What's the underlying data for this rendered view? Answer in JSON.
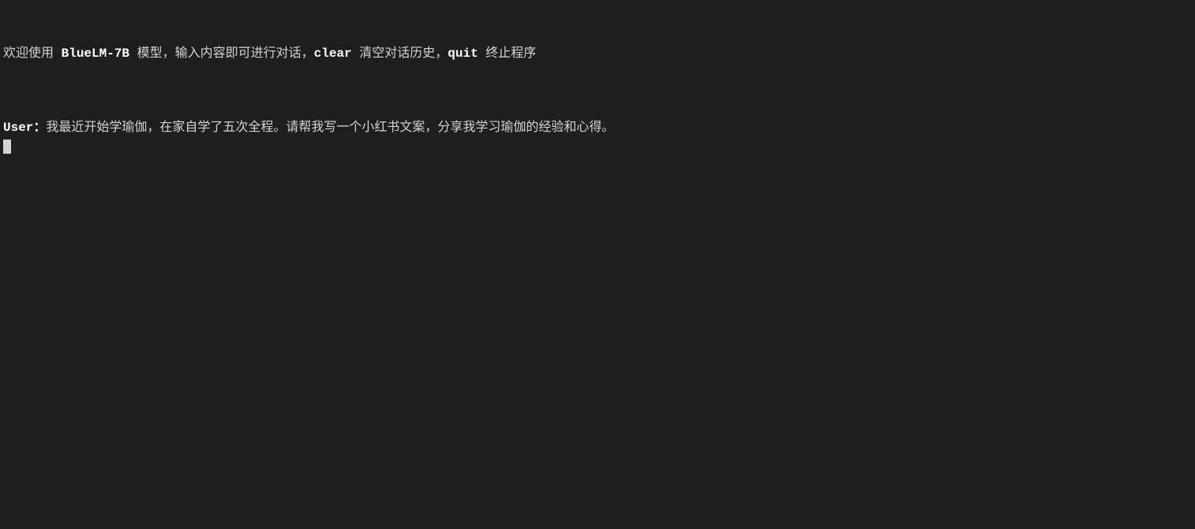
{
  "welcome": {
    "part1": "欢迎使用 ",
    "model_name": "BlueLM-7B",
    "part2": " 模型，输入内容即可进行对话，",
    "clear_cmd": "clear",
    "part3": " 清空对话历史，",
    "quit_cmd": "quit",
    "part4": " 终止程序"
  },
  "prompt": {
    "label": "User：",
    "input": "我最近开始学瑜伽，在家自学了五次全程。请帮我写一个小红书文案，分享我学习瑜伽的经验和心得。"
  }
}
